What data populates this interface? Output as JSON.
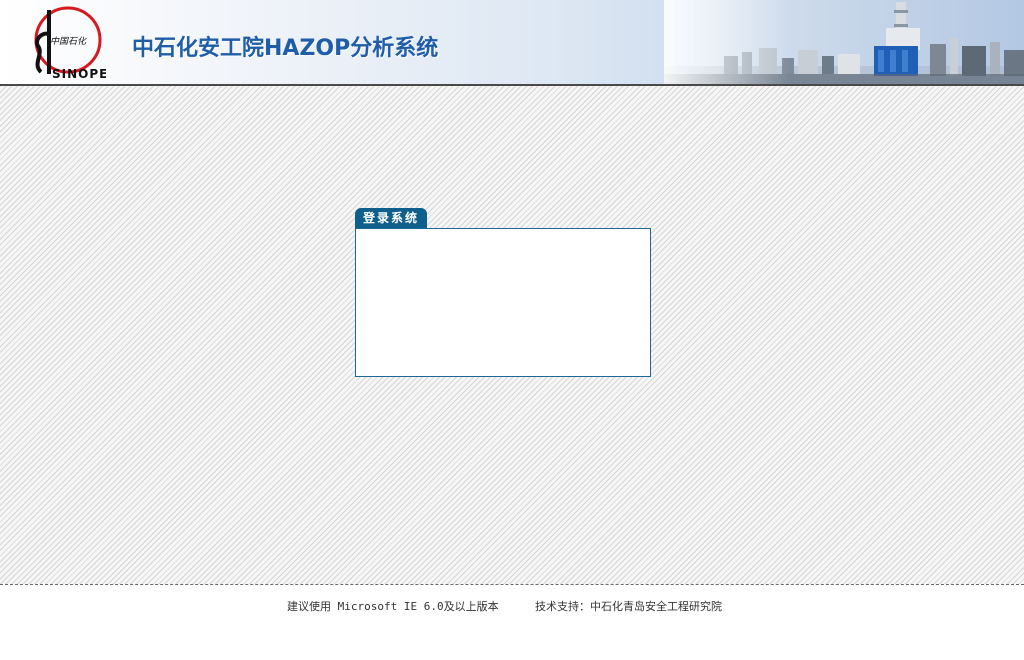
{
  "header": {
    "logo_text": "SINOPEC",
    "logo_chinese": "中国石化",
    "title": "中石化安工院HAZOP分析系统"
  },
  "login": {
    "tab_label": "登录系统"
  },
  "footer": {
    "browser_note": "建议使用 Microsoft IE 6.0及以上版本",
    "tech_support": "技术支持：中石化青岛安全工程研究院"
  },
  "colors": {
    "title_blue": "#1f5da8",
    "tab_blue": "#0e5f8c",
    "logo_red": "#d71920"
  }
}
